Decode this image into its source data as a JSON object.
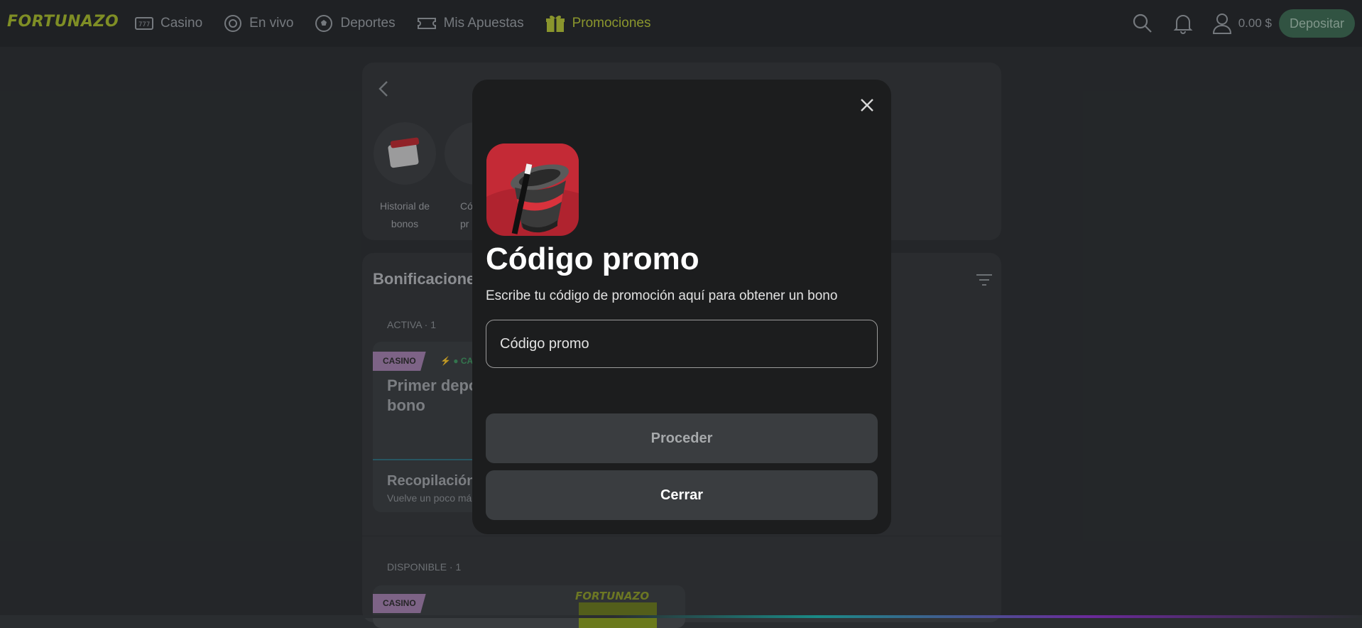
{
  "brand": {
    "logo_text": "FORTUNAZO",
    "accent": "#b7c735",
    "deposit_color": "#3c6b52"
  },
  "nav": {
    "items": [
      {
        "label": "Casino",
        "icon": "slot-machine-icon"
      },
      {
        "label": "En vivo",
        "icon": "live-chip-icon"
      },
      {
        "label": "Deportes",
        "icon": "soccer-ball-icon"
      },
      {
        "label": "Mis Apuestas",
        "icon": "ticket-icon"
      },
      {
        "label": "Promociones",
        "icon": "gift-icon",
        "active": true
      }
    ]
  },
  "header": {
    "balance": "0.00 $",
    "deposit_label": "Depositar"
  },
  "background": {
    "quick_links": [
      {
        "label_line1": "Historial de",
        "label_line2": "bonos"
      },
      {
        "label_line1": "Có",
        "label_line2": "pr"
      }
    ],
    "section_title": "Bonificacione",
    "active_label": "ACTIVA · 1",
    "available_label": "DISPONIBLE · 1",
    "tag_casino": "CASINO",
    "tag_small": "CA",
    "active_bonus_title_line1": "Primer depo",
    "active_bonus_title_line2": "bono",
    "collect_title": "Recopilación",
    "collect_sub": "Vuelve un poco má",
    "banner_logo": "FORTUNAZO"
  },
  "modal": {
    "title": "Código promo",
    "subtitle": "Escribe tu código de promoción aquí para obtener un bono",
    "input_placeholder": "Código promo",
    "input_value": "",
    "proceed_label": "Proceder",
    "close_label": "Cerrar"
  }
}
